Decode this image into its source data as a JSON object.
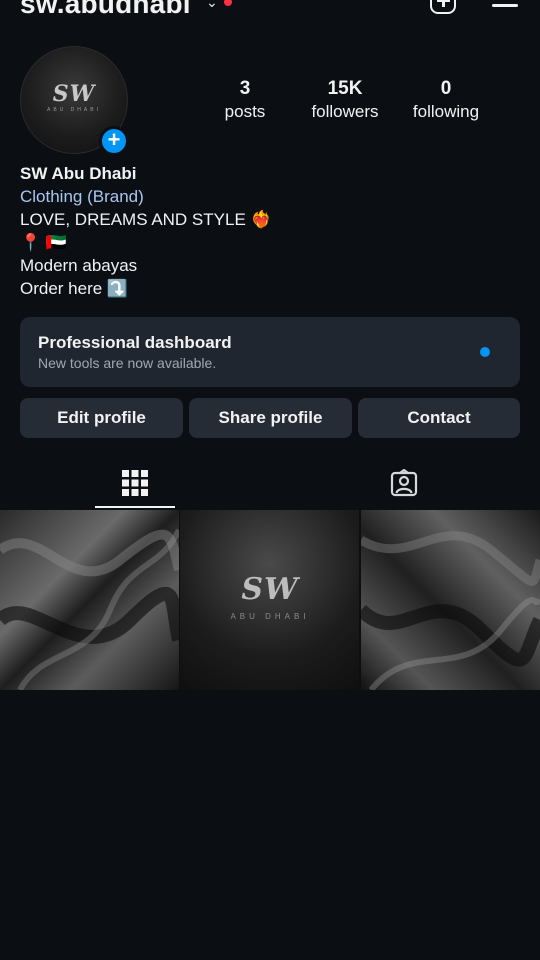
{
  "header": {
    "username": "sw.abudhabi",
    "chevron": "⌄",
    "icons": [
      "chevron-down-icon",
      "notification-dot",
      "new-post-icon",
      "menu-icon"
    ]
  },
  "profile": {
    "avatar_logo": "SW",
    "avatar_sub": "ABU DHABI",
    "add_story_symbol": "+",
    "stats": [
      {
        "value": "3",
        "label": "posts"
      },
      {
        "value": "15K",
        "label": "followers"
      },
      {
        "value": "0",
        "label": "following"
      }
    ]
  },
  "bio": {
    "name": "SW Abu Dhabi",
    "category": "Clothing (Brand)",
    "line1": "LOVE, DREAMS AND STYLE ❤️‍🔥",
    "line2": "📍 🇦🇪",
    "line3": "Modern abayas",
    "line4": "Order here ⤵️"
  },
  "dashboard": {
    "title": "Professional dashboard",
    "subtitle": "New tools are now available."
  },
  "actions": {
    "edit": "Edit profile",
    "share": "Share profile",
    "contact": "Contact"
  },
  "tabs": [
    "grid-icon",
    "tagged-icon"
  ],
  "posts": [
    {
      "type": "satin-fabric"
    },
    {
      "type": "logo",
      "logo": "SW",
      "sub": "ABU DHABI"
    },
    {
      "type": "satin-fabric"
    }
  ],
  "colors": {
    "background": "#0b0f14",
    "accent_blue": "#0095f6",
    "notification_red": "#ff3040",
    "category_link": "#a8c7f0",
    "button_bg": "#262c35",
    "dashboard_bg": "#1f2630"
  }
}
